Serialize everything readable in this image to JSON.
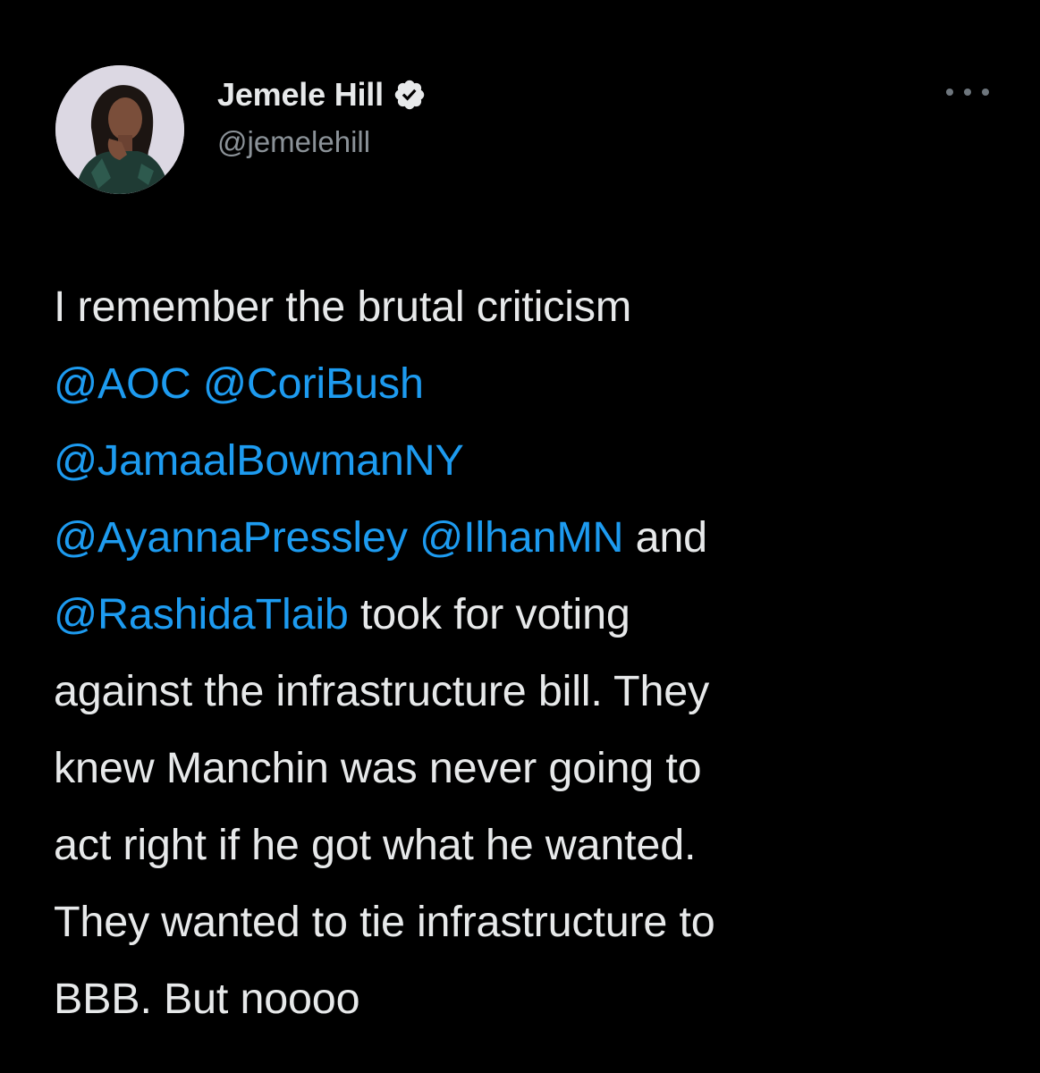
{
  "tweet": {
    "author": {
      "display_name": "Jemele Hill",
      "handle": "@jemelehill",
      "verified_icon": "verified-badge-icon",
      "avatar": "profile-photo"
    },
    "more_icon": "more-options-icon",
    "lines": [
      [
        {
          "t": "I remember the brutal criticism",
          "m": false
        }
      ],
      [
        {
          "t": "@AOC",
          "m": true
        },
        {
          "t": " ",
          "m": false
        },
        {
          "t": "@CoriBush",
          "m": true
        }
      ],
      [
        {
          "t": "@JamaalBowmanNY",
          "m": true
        }
      ],
      [
        {
          "t": "@AyannaPressley",
          "m": true
        },
        {
          "t": " ",
          "m": false
        },
        {
          "t": "@IlhanMN",
          "m": true
        },
        {
          "t": " and",
          "m": false
        }
      ],
      [
        {
          "t": "@RashidaTlaib",
          "m": true
        },
        {
          "t": " took for voting",
          "m": false
        }
      ],
      [
        {
          "t": "against the infrastructure bill. They",
          "m": false
        }
      ],
      [
        {
          "t": "knew Manchin was never going to",
          "m": false
        }
      ],
      [
        {
          "t": "act right if he got what he wanted.",
          "m": false
        }
      ],
      [
        {
          "t": "They wanted to tie infrastructure to",
          "m": false
        }
      ],
      [
        {
          "t": "BBB. But noooo",
          "m": false
        }
      ]
    ],
    "colors": {
      "background": "#000000",
      "text": "#e7e9ea",
      "mention": "#1d9bf0",
      "secondary": "#8b9298",
      "verified": "#e7e9ea"
    }
  }
}
